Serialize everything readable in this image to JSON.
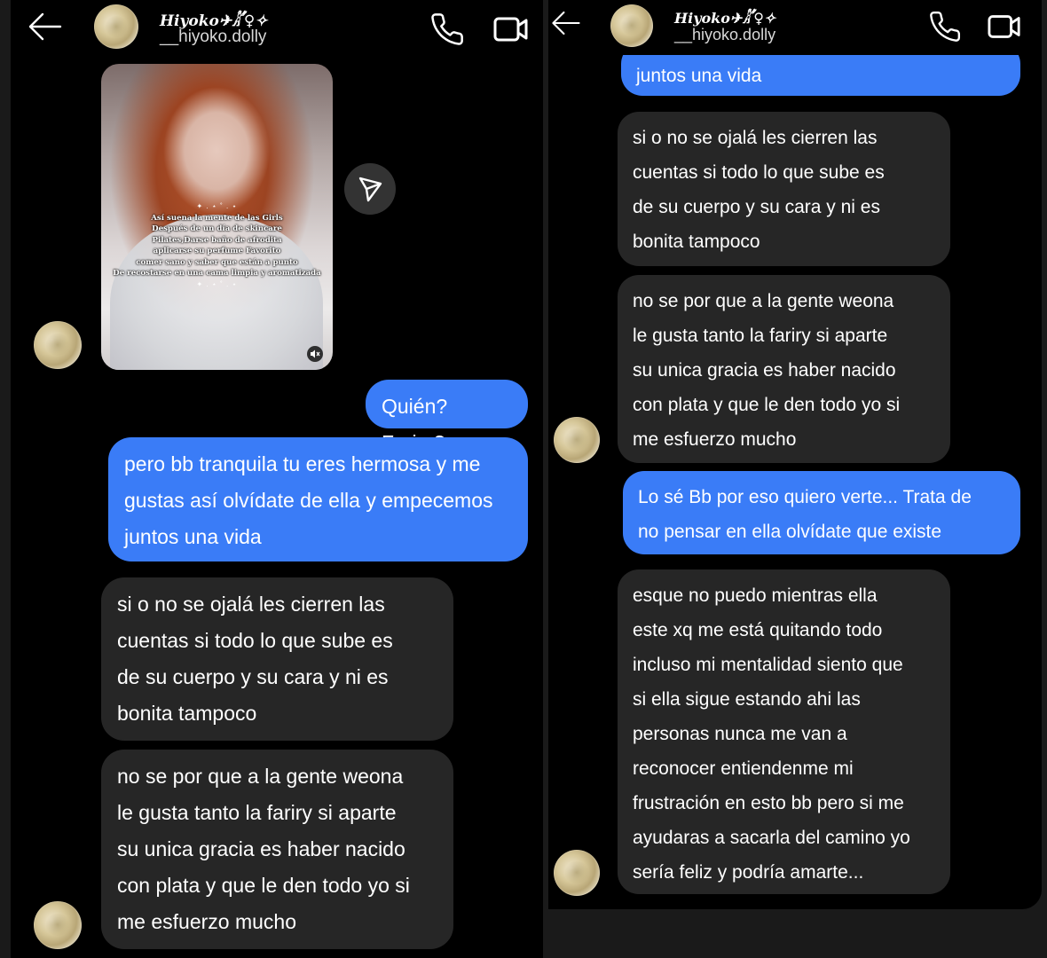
{
  "contact": {
    "name": "Hiyoko✈𓀣♀︎✧",
    "username": "__hiyoko.dolly"
  },
  "left": {
    "photo_caption": "Así suena la mente de las Girls\nDespués de un día de skincare\nPilates,Darse baño de afrodita\naplicarse su perfume Favorito\ncomer sano  y saber  que están a punto\nDe recostarse en una cama limpia y aromatizada",
    "photo_stars": "✦ . ⋆ ˚ . ⋆",
    "messages": [
      {
        "text": "Quién? Fariry?"
      },
      {
        "text": "pero bb tranquila tu eres hermosa y me\ngustas así olvídate de ella y empecemos\njuntos una vida"
      },
      {
        "text": "si o no se ojalá les cierren las\ncuentas si todo lo que sube es\nde su cuerpo y su cara y ni es\nbonita tampoco"
      },
      {
        "text": "no se por que a la gente weona\nle gusta tanto la fariry si aparte\nsu unica gracia es haber nacido\ncon plata y que le den todo yo si\nme esfuerzo mucho"
      }
    ]
  },
  "right": {
    "messages": [
      {
        "text": "juntos una vida"
      },
      {
        "text": "si o no se ojalá les cierren las\ncuentas si todo lo que sube es\nde su cuerpo y su cara y ni es\nbonita tampoco"
      },
      {
        "text": "no se por que a la gente weona\nle gusta tanto la fariry si aparte\nsu unica gracia es haber nacido\ncon plata y que le den todo yo si\nme esfuerzo mucho"
      },
      {
        "text": "Lo sé Bb por eso quiero verte... Trata de\nno pensar en ella olvídate que existe"
      },
      {
        "text": "esque no puedo mientras ella\neste xq me está quitando todo\nincluso mi mentalidad siento que\nsi ella sigue estando ahi las\npersonas nunca me van a\nreconocer entiendenme mi\nfrustración en esto bb pero si me\nayudaras a sacarla del camino yo\nsería feliz y podría amarte..."
      }
    ]
  },
  "icons": {
    "back": "arrow-left-icon",
    "phone": "phone-icon",
    "video": "video-camera-icon",
    "share": "send-icon",
    "mute": "speaker-muted-icon"
  },
  "colors": {
    "background": "#000000",
    "received_bubble": "#262626",
    "sent_bubble": "#3a7cf7",
    "text": "#ffffff"
  }
}
